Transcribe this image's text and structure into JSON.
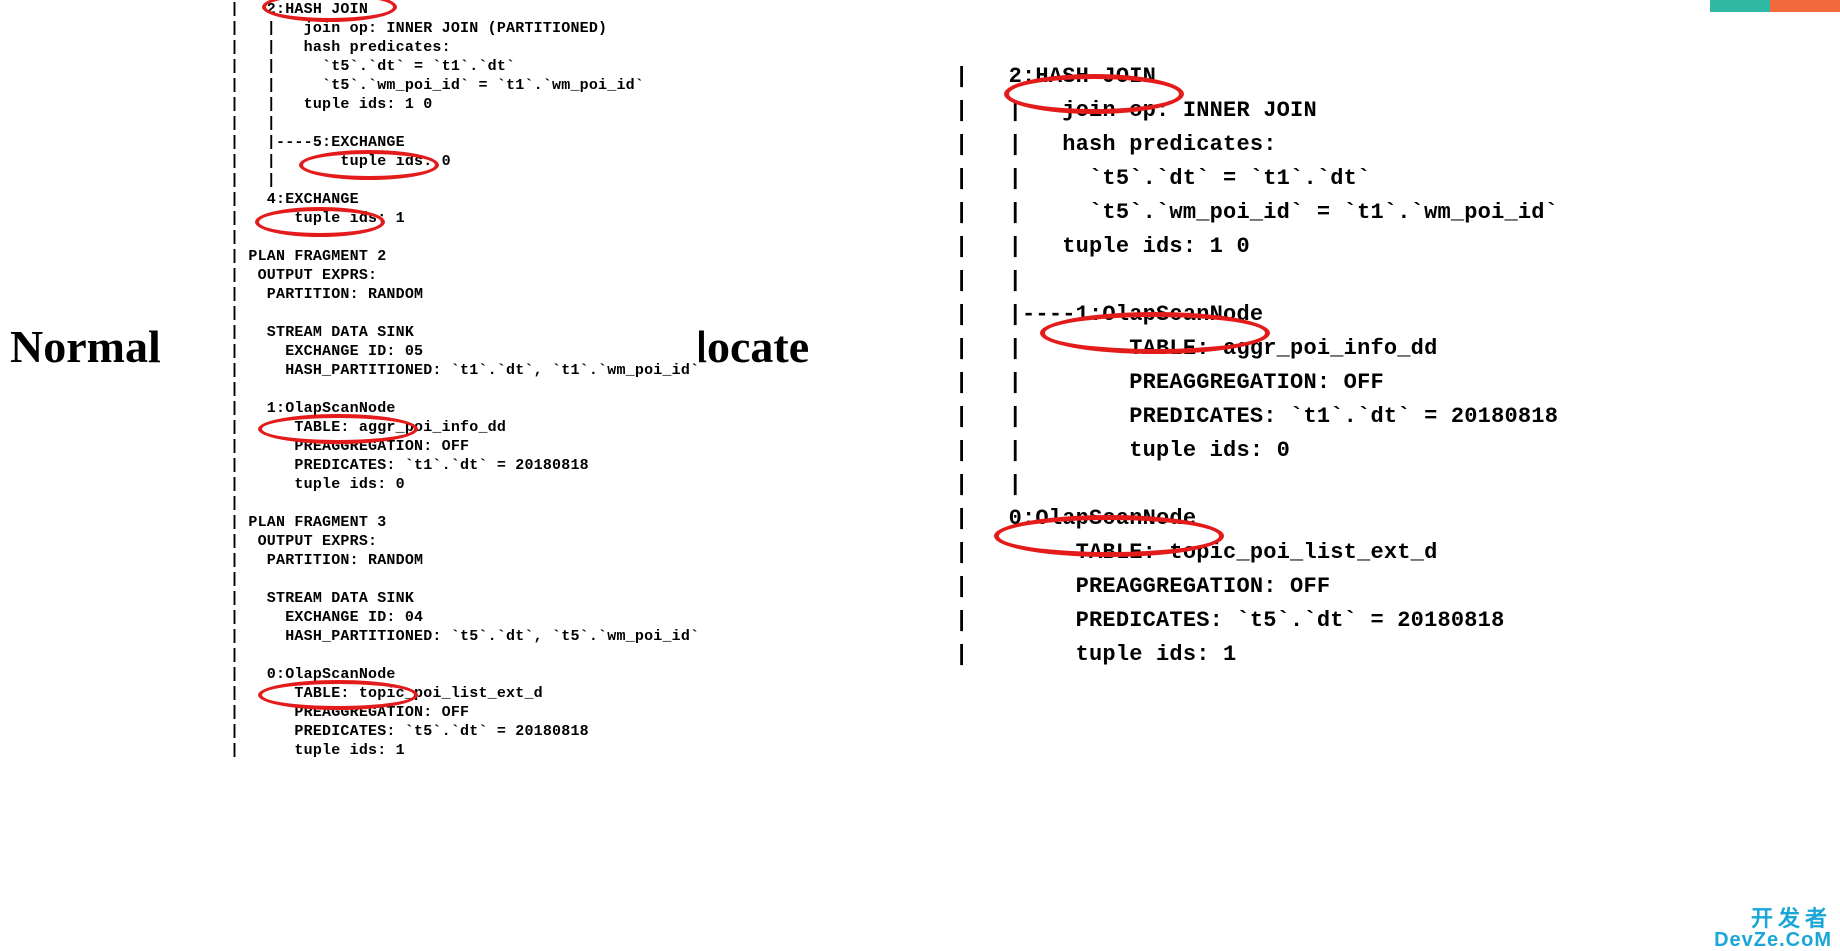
{
  "labels": {
    "normal": "Normal",
    "colocate": "Colocate"
  },
  "normal_plan": {
    "lines": [
      "|   2:HASH JOIN",
      "|   |   join op: INNER JOIN (PARTITIONED)",
      "|   |   hash predicates:",
      "|   |     `t5`.`dt` = `t1`.`dt`",
      "|   |     `t5`.`wm_poi_id` = `t1`.`wm_poi_id`",
      "|   |   tuple ids: 1 0",
      "|   |",
      "|   |----5:EXCHANGE",
      "|   |       tuple ids: 0",
      "|   |",
      "|   4:EXCHANGE",
      "|      tuple ids: 1",
      "|",
      "| PLAN FRAGMENT 2",
      "|  OUTPUT EXPRS:",
      "|   PARTITION: RANDOM",
      "|",
      "|   STREAM DATA SINK",
      "|     EXCHANGE ID: 05",
      "|     HASH_PARTITIONED: `t1`.`dt`, `t1`.`wm_poi_id`",
      "|",
      "|   1:OlapScanNode",
      "|      TABLE: aggr_poi_info_dd",
      "|      PREAGGREGATION: OFF",
      "|      PREDICATES: `t1`.`dt` = 20180818",
      "|      tuple ids: 0",
      "|",
      "| PLAN FRAGMENT 3",
      "|  OUTPUT EXPRS:",
      "|   PARTITION: RANDOM",
      "|",
      "|   STREAM DATA SINK",
      "|     EXCHANGE ID: 04",
      "|     HASH_PARTITIONED: `t5`.`dt`, `t5`.`wm_poi_id`",
      "|",
      "|   0:OlapScanNode",
      "|      TABLE: topic_poi_list_ext_d",
      "|      PREAGGREGATION: OFF",
      "|      PREDICATES: `t5`.`dt` = 20180818",
      "|      tuple ids: 1"
    ]
  },
  "colocate_plan": {
    "lines": [
      "|   2:HASH JOIN",
      "|   |   join op: INNER JOIN",
      "|   |   hash predicates:",
      "|   |     `t5`.`dt` = `t1`.`dt`",
      "|   |     `t5`.`wm_poi_id` = `t1`.`wm_poi_id`",
      "|   |   tuple ids: 1 0",
      "|   |",
      "|   |----1:OlapScanNode",
      "|   |        TABLE: aggr_poi_info_dd",
      "|   |        PREAGGREGATION: OFF",
      "|   |        PREDICATES: `t1`.`dt` = 20180818",
      "|   |        tuple ids: 0",
      "|   |",
      "|   0:OlapScanNode",
      "|        TABLE: topic_poi_list_ext_d",
      "|        PREAGGREGATION: OFF",
      "|        PREDICATES: `t5`.`dt` = 20180818",
      "|        tuple ids: 1"
    ]
  },
  "highlights": {
    "normal": [
      "2:HASH JOIN",
      "5:EXCHANGE",
      "4:EXCHANGE",
      "1:OlapScanNode",
      "0:OlapScanNode"
    ],
    "colocate": [
      "2:HASH JOIN",
      "1:OlapScanNode",
      "0:OlapScanNode"
    ]
  },
  "watermark": {
    "line1": "开发者",
    "line2": "DevZe.CoM"
  }
}
